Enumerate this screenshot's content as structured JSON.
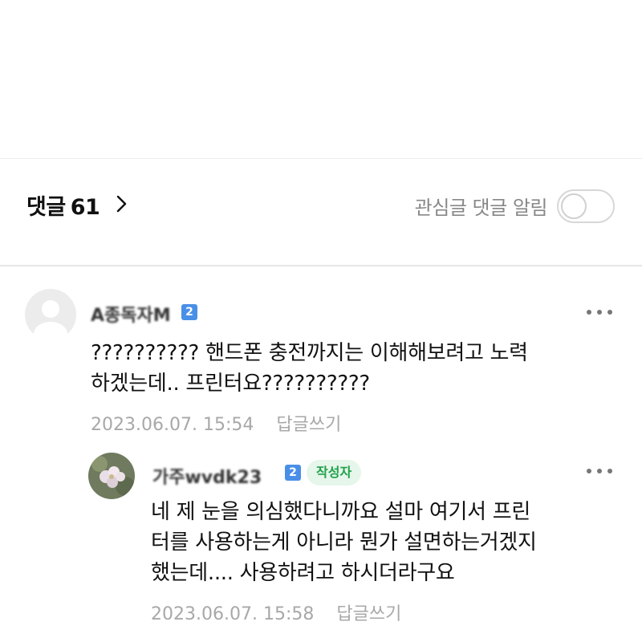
{
  "header": {
    "comments_label": "댓글",
    "comments_count": "61",
    "alert_label": "관심글 댓글 알림",
    "alert_toggle_on": false
  },
  "comments": [
    {
      "nickname": "A종독자M",
      "level": "2",
      "text_lines": [
        "?????????? 핸드폰 충전까지는 이해해보려고 노력",
        "하겠는데.. 프린터요??????????"
      ],
      "date": "2023.06.07. 15:54",
      "reply_label": "답글쓰기",
      "more_icon": "more-dots-icon",
      "avatar_icon": "default-avatar-icon"
    },
    {
      "nickname": "가주wvdk23",
      "level": "2",
      "author_badge": "작성자",
      "text_lines": [
        "네 제 눈을 의심했다니까요 설마 여기서 프린",
        "터를 사용하는게 아니라 뭔가 설면하는거겠지",
        "했는데.... 사용하려고 하시더라구요"
      ],
      "date": "2023.06.07. 15:58",
      "reply_label": "답글쓰기",
      "more_icon": "more-dots-icon",
      "avatar_icon": "flower-avatar-icon"
    }
  ],
  "colors": {
    "level_badge": "#4a8fe7",
    "author_badge_bg": "#e6f6ea",
    "author_badge_text": "#20a14b",
    "meta_text": "#a8a8a8"
  }
}
